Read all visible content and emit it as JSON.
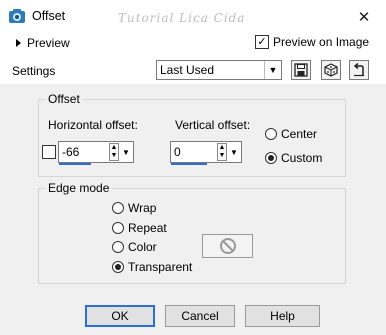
{
  "window": {
    "title": "Offset",
    "watermark": "Tutorial Lica Cida",
    "close_symbol": "✕"
  },
  "preview": {
    "label": "Preview",
    "checkbox_label": "Preview on Image",
    "checked": true,
    "check_glyph": "✓"
  },
  "settings": {
    "label": "Settings",
    "selected": "Last Used",
    "arrow": "▼"
  },
  "offset": {
    "legend": "Offset",
    "horizontal_label": "Horizontal offset:",
    "horizontal_value": "-66",
    "vertical_label": "Vertical offset:",
    "vertical_value": "0",
    "spin_up": "▲",
    "spin_down": "▼",
    "link_checked": false,
    "position_options": [
      "Center",
      "Custom"
    ],
    "position_selected": "Custom"
  },
  "edge_mode": {
    "legend": "Edge mode",
    "options": [
      "Wrap",
      "Repeat",
      "Color",
      "Transparent"
    ],
    "selected": "Transparent"
  },
  "buttons": {
    "ok": "OK",
    "cancel": "Cancel",
    "help": "Help"
  },
  "icons": {
    "app": "offset-app-icon",
    "save": "save-preset-icon",
    "random": "randomize-dice-icon",
    "reset": "reset-arrow-icon",
    "no_color": "no-color-icon"
  },
  "colors": {
    "accent": "#2d6fd6",
    "dialog_bg": "#f0f0f0",
    "titlebar_bg": "#ffffff"
  }
}
